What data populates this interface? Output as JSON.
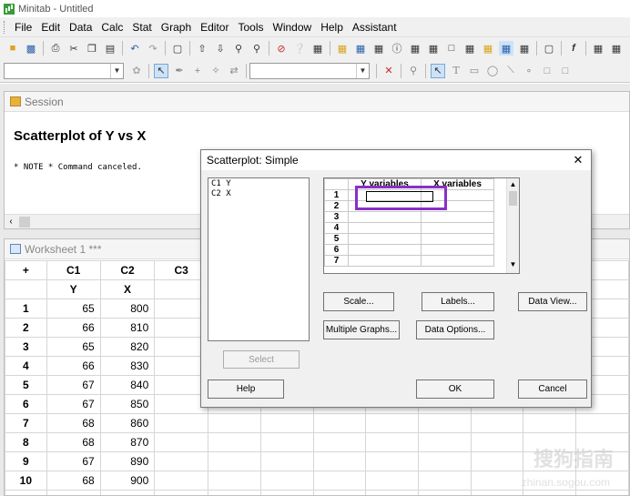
{
  "window": {
    "title": "Minitab - Untitled"
  },
  "menu": [
    "File",
    "Edit",
    "Data",
    "Calc",
    "Stat",
    "Graph",
    "Editor",
    "Tools",
    "Window",
    "Help",
    "Assistant"
  ],
  "session": {
    "title": "Session",
    "heading": "Scatterplot of Y vs X",
    "note": "* NOTE * Command canceled."
  },
  "worksheet": {
    "title": "Worksheet 1 ***",
    "corner_symbol": "+",
    "columns": [
      "C1",
      "C2",
      "C3"
    ],
    "names": [
      "Y",
      "X",
      ""
    ],
    "rows": [
      {
        "num": "1",
        "c1": "65",
        "c2": "800"
      },
      {
        "num": "2",
        "c1": "66",
        "c2": "810"
      },
      {
        "num": "3",
        "c1": "65",
        "c2": "820"
      },
      {
        "num": "4",
        "c1": "66",
        "c2": "830"
      },
      {
        "num": "5",
        "c1": "67",
        "c2": "840"
      },
      {
        "num": "6",
        "c1": "67",
        "c2": "850"
      },
      {
        "num": "7",
        "c1": "68",
        "c2": "860"
      },
      {
        "num": "8",
        "c1": "68",
        "c2": "870"
      },
      {
        "num": "9",
        "c1": "67",
        "c2": "890"
      },
      {
        "num": "10",
        "c1": "68",
        "c2": "900"
      },
      {
        "num": "11",
        "c1": "",
        "c2": ""
      }
    ]
  },
  "dialog": {
    "title": "Scatterplot: Simple",
    "variables": [
      "C1   Y",
      "C2   X"
    ],
    "grid_headers": [
      "Y variables",
      "X variables"
    ],
    "grid_rows": [
      "1",
      "2",
      "3",
      "4",
      "5",
      "6",
      "7"
    ],
    "buttons": {
      "select": "Select",
      "scale": "Scale...",
      "labels": "Labels...",
      "data_view": "Data View...",
      "multiple_graphs": "Multiple Graphs...",
      "data_options": "Data Options...",
      "help": "Help",
      "ok": "OK",
      "cancel": "Cancel"
    }
  },
  "watermark": {
    "main": "搜狗指南",
    "sub": "zhinan.sogou.com"
  }
}
